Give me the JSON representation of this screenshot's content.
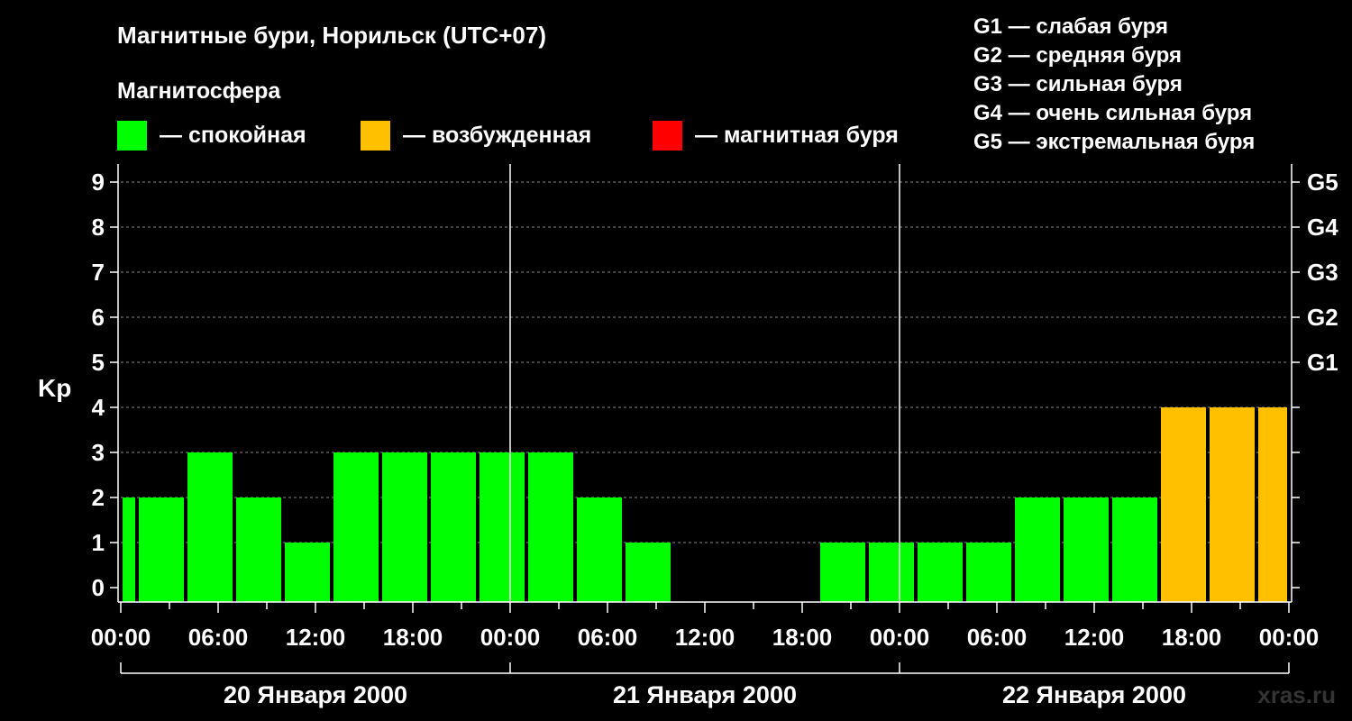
{
  "chart_data": {
    "type": "bar",
    "title": "Магнитные бури, Норильск (UTC+07)",
    "legend_title": "Магнитосфера",
    "legend": [
      {
        "label": "— спокойная",
        "color": "#00FF00"
      },
      {
        "label": "— возбужденная",
        "color": "#FFC000"
      },
      {
        "label": "— магнитная буря",
        "color": "#FF0000"
      }
    ],
    "g_scale": [
      "G1 — слабая буря",
      "G2 — средняя буря",
      "G3 — сильная буря",
      "G4 — очень сильная буря",
      "G5 — экстремальная буря"
    ],
    "ylabel": "Kp",
    "ylim": [
      0,
      9
    ],
    "y_ticks": [
      "0",
      "1",
      "2",
      "3",
      "4",
      "5",
      "6",
      "7",
      "8",
      "9"
    ],
    "right_ticks": [
      {
        "value": 5,
        "label": "G1"
      },
      {
        "value": 6,
        "label": "G2"
      },
      {
        "value": 7,
        "label": "G3"
      },
      {
        "value": 8,
        "label": "G4"
      },
      {
        "value": 9,
        "label": "G5"
      }
    ],
    "x_range_hours": [
      0,
      72
    ],
    "x_tick_labels": [
      {
        "hour": 0,
        "label": "00:00"
      },
      {
        "hour": 6,
        "label": "06:00"
      },
      {
        "hour": 12,
        "label": "12:00"
      },
      {
        "hour": 18,
        "label": "18:00"
      },
      {
        "hour": 24,
        "label": "00:00"
      },
      {
        "hour": 30,
        "label": "06:00"
      },
      {
        "hour": 36,
        "label": "12:00"
      },
      {
        "hour": 42,
        "label": "18:00"
      },
      {
        "hour": 48,
        "label": "00:00"
      },
      {
        "hour": 54,
        "label": "06:00"
      },
      {
        "hour": 60,
        "label": "12:00"
      },
      {
        "hour": 66,
        "label": "18:00"
      },
      {
        "hour": 72,
        "label": "00:00"
      }
    ],
    "days": [
      {
        "label": "20 Января 2000",
        "start": 0,
        "end": 24
      },
      {
        "label": "21 Января 2000",
        "start": 24,
        "end": 48
      },
      {
        "label": "22 Января 2000",
        "start": 48,
        "end": 72
      }
    ],
    "grid": true,
    "bars": [
      {
        "start": 0,
        "end": 1,
        "kp": 2,
        "color": "#00FF00"
      },
      {
        "start": 1,
        "end": 4,
        "kp": 2,
        "color": "#00FF00"
      },
      {
        "start": 4,
        "end": 7,
        "kp": 3,
        "color": "#00FF00"
      },
      {
        "start": 7,
        "end": 10,
        "kp": 2,
        "color": "#00FF00"
      },
      {
        "start": 10,
        "end": 13,
        "kp": 1,
        "color": "#00FF00"
      },
      {
        "start": 13,
        "end": 16,
        "kp": 3,
        "color": "#00FF00"
      },
      {
        "start": 16,
        "end": 19,
        "kp": 3,
        "color": "#00FF00"
      },
      {
        "start": 19,
        "end": 22,
        "kp": 3,
        "color": "#00FF00"
      },
      {
        "start": 22,
        "end": 25,
        "kp": 3,
        "color": "#00FF00"
      },
      {
        "start": 25,
        "end": 28,
        "kp": 3,
        "color": "#00FF00"
      },
      {
        "start": 28,
        "end": 31,
        "kp": 2,
        "color": "#00FF00"
      },
      {
        "start": 31,
        "end": 34,
        "kp": 1,
        "color": "#00FF00"
      },
      {
        "start": 34,
        "end": 37,
        "kp": 0,
        "color": "#00FF00"
      },
      {
        "start": 37,
        "end": 40,
        "kp": 0,
        "color": "#00FF00"
      },
      {
        "start": 40,
        "end": 43,
        "kp": 0,
        "color": "#00FF00"
      },
      {
        "start": 43,
        "end": 46,
        "kp": 1,
        "color": "#00FF00"
      },
      {
        "start": 46,
        "end": 49,
        "kp": 1,
        "color": "#00FF00"
      },
      {
        "start": 49,
        "end": 52,
        "kp": 1,
        "color": "#00FF00"
      },
      {
        "start": 52,
        "end": 55,
        "kp": 1,
        "color": "#00FF00"
      },
      {
        "start": 55,
        "end": 58,
        "kp": 2,
        "color": "#00FF00"
      },
      {
        "start": 58,
        "end": 61,
        "kp": 2,
        "color": "#00FF00"
      },
      {
        "start": 61,
        "end": 64,
        "kp": 2,
        "color": "#00FF00"
      },
      {
        "start": 64,
        "end": 67,
        "kp": 4,
        "color": "#FFC000"
      },
      {
        "start": 67,
        "end": 70,
        "kp": 4,
        "color": "#FFC000"
      },
      {
        "start": 70,
        "end": 72,
        "kp": 4,
        "color": "#FFC000"
      }
    ],
    "watermark": "xras.ru"
  }
}
